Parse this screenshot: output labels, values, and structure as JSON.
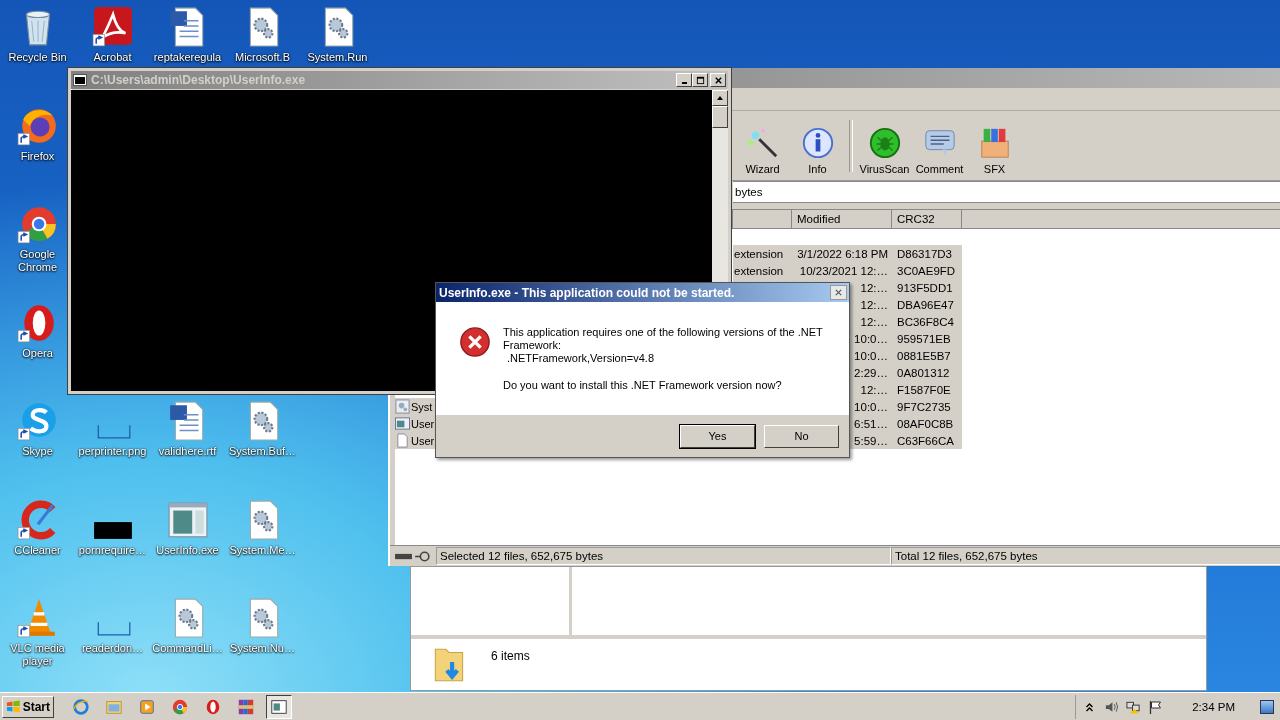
{
  "desktop": {
    "top_row": [
      {
        "label": "Recycle Bin",
        "kind": "recycle",
        "shortcut": false
      },
      {
        "label": "Acrobat",
        "kind": "acrobat",
        "shortcut": true
      },
      {
        "label": "reptakeregula",
        "kind": "word",
        "shortcut": false
      },
      {
        "label": "Microsoft.B",
        "kind": "gears",
        "shortcut": false
      },
      {
        "label": "System.Run",
        "kind": "gears",
        "shortcut": false
      }
    ],
    "left_column": [
      {
        "label": "Firefox",
        "kind": "firefox",
        "shortcut": true
      },
      {
        "label": "Google Chrome",
        "kind": "chrome",
        "shortcut": true
      },
      {
        "label": "Opera",
        "kind": "opera",
        "shortcut": true
      },
      {
        "label": "Skype",
        "kind": "skype",
        "shortcut": true
      },
      {
        "label": "CCleaner",
        "kind": "ccleaner",
        "shortcut": true
      },
      {
        "label": "VLC media player",
        "kind": "vlc",
        "shortcut": true
      }
    ],
    "lower_block": [
      {
        "label": "perprinter.png",
        "kind": "blank",
        "shortcut": false
      },
      {
        "label": "validhere.rtf",
        "kind": "word",
        "shortcut": false
      },
      {
        "label": "System.Buf…",
        "kind": "gears",
        "shortcut": false
      },
      {
        "label": "pornrequire…",
        "kind": "black",
        "shortcut": false
      },
      {
        "label": "UserInfo.exe",
        "kind": "window",
        "shortcut": false
      },
      {
        "label": "System.Me…",
        "kind": "gears",
        "shortcut": false
      },
      {
        "label": "readerdon…",
        "kind": "blank",
        "shortcut": false
      },
      {
        "label": "CommandLi…",
        "kind": "gears",
        "shortcut": false
      },
      {
        "label": "System.Nu…",
        "kind": "gears",
        "shortcut": false
      }
    ]
  },
  "console": {
    "title": "C:\\Users\\admin\\Desktop\\UserInfo.exe"
  },
  "archiver": {
    "toolbar": [
      {
        "label": "Wizard",
        "kind": "wizard"
      },
      {
        "label": "Info",
        "kind": "info"
      },
      {
        "label": "VirusScan",
        "kind": "virus"
      },
      {
        "label": "Comment",
        "kind": "comment"
      },
      {
        "label": "SFX",
        "kind": "sfx"
      }
    ],
    "address": "bytes",
    "columns": [
      "Modified",
      "CRC32"
    ],
    "rows": [
      {
        "type": "extension",
        "modified": "3/1/2022 6:18 PM",
        "crc": "D86317D3",
        "selected": true
      },
      {
        "type": "extension",
        "modified": "10/23/2021 12:…",
        "crc": "3C0AE9FD",
        "selected": true
      },
      {
        "modified": "12:…",
        "crc": "913F5DD1",
        "selected": true
      },
      {
        "modified": "12:…",
        "crc": "DBA96E47",
        "selected": true
      },
      {
        "modified": "12:…",
        "crc": "BC36F8C4",
        "selected": true
      },
      {
        "modified": "10:0…",
        "crc": "959571EB",
        "selected": true
      },
      {
        "modified": "10:0…",
        "crc": "0881E5B7",
        "selected": true
      },
      {
        "modified": "2:29…",
        "crc": "0A801312",
        "selected": true
      },
      {
        "modified": "12:…",
        "crc": "F1587F0E",
        "selected": true
      },
      {
        "name": "Syst",
        "kind": "gears",
        "modified": "10:0…",
        "crc": "9F7C2735",
        "selected": true
      },
      {
        "name": "User",
        "kind": "window",
        "modified": "6:51…",
        "crc": "08AF0C8B",
        "selected": true
      },
      {
        "name": "User",
        "kind": "file",
        "modified": "5:59…",
        "crc": "C63F66CA",
        "selected": true
      }
    ],
    "status": {
      "left": "Selected 12 files, 652,675 bytes",
      "right": "Total 12 files, 652,675 bytes"
    }
  },
  "dialog": {
    "title": "UserInfo.exe - This application could not be started.",
    "message": "This application requires one of the following versions of the .NET Framework:",
    "requirement": ".NETFramework,Version=v4.8",
    "question": "Do you want to install this .NET Framework version now?",
    "buttons": [
      {
        "label": "Yes",
        "default": true
      },
      {
        "label": "No",
        "default": false
      }
    ]
  },
  "explorer": {
    "details": "6 items"
  },
  "taskbar": {
    "start": "Start",
    "apps": [
      {
        "kind": "ie",
        "active": false
      },
      {
        "kind": "folder",
        "active": false
      },
      {
        "kind": "media",
        "active": false
      },
      {
        "kind": "chrome",
        "active": false
      },
      {
        "kind": "opera",
        "active": false
      },
      {
        "kind": "archive",
        "active": false
      },
      {
        "kind": "console",
        "active": true
      }
    ],
    "clock": "2:34 PM"
  }
}
